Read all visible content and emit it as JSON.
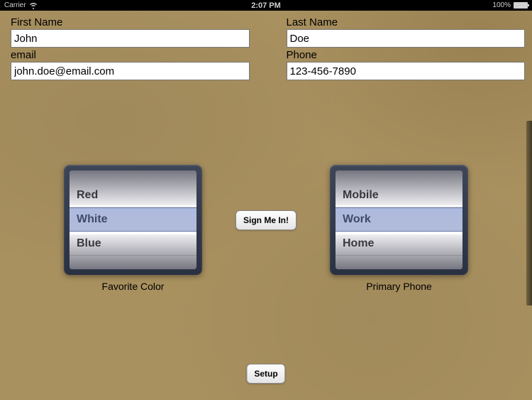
{
  "status": {
    "carrier": "Carrier",
    "time": "2:07 PM",
    "battery": "100%"
  },
  "form": {
    "first_name_label": "First Name",
    "first_name_value": "John",
    "last_name_label": "Last Name",
    "last_name_value": "Doe",
    "email_label": "email",
    "email_value": "john.doe@email.com",
    "phone_label": "Phone",
    "phone_value": "123-456-7890"
  },
  "pickers": {
    "color": {
      "label": "Favorite Color",
      "options": [
        "Red",
        "White",
        "Blue"
      ],
      "selected": "White"
    },
    "phone_type": {
      "label": "Primary Phone",
      "options": [
        "Mobile",
        "Work",
        "Home"
      ],
      "selected": "Work"
    }
  },
  "buttons": {
    "sign_in": "Sign Me In!",
    "setup": "Setup"
  }
}
